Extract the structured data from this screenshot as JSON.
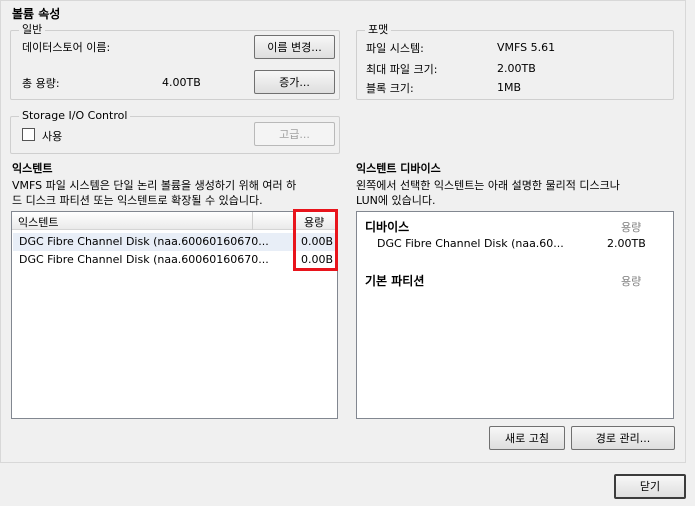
{
  "dialog": {
    "title": "볼륨 속성"
  },
  "general": {
    "group_label": "일반",
    "datastore_name_label": "데이터스토어 이름:",
    "rename_button": "이름 변경...",
    "total_capacity_label": "총 용량:",
    "total_capacity_value": "4.00TB",
    "increase_button": "증가..."
  },
  "format": {
    "group_label": "포맷",
    "filesystem_label": "파일 시스템:",
    "filesystem_value": "VMFS 5.61",
    "max_file_size_label": "최대 파일 크기:",
    "max_file_size_value": "2.00TB",
    "block_size_label": "블록 크기:",
    "block_size_value": "1MB"
  },
  "storage_io": {
    "group_label": "Storage I/O Control",
    "enable_label": "사용",
    "enabled": false,
    "advanced_button": "고급..."
  },
  "extents": {
    "heading": "익스텐트",
    "description_line1": "VMFS 파일 시스템은 단일 논리 볼륨을 생성하기 위해 여러 하",
    "description_line2": "드 디스크 파티션 또는 익스텐트로 확장될 수 있습니다.",
    "columns": {
      "name": "익스텐트",
      "capacity": "용량"
    },
    "rows": [
      {
        "name": "DGC Fibre Channel Disk (naa.60060160670...",
        "capacity": "0.00B"
      },
      {
        "name": "DGC Fibre Channel Disk (naa.60060160670...",
        "capacity": "0.00B"
      }
    ]
  },
  "extent_device": {
    "heading": "익스텐트 디바이스",
    "description_line1": "왼쪽에서 선택한 익스텐트는 아래 설명한 물리적 디스크나",
    "description_line2": "LUN에 있습니다.",
    "device_header": "디바이스",
    "device_capacity_header": "용량",
    "device_name": "DGC Fibre Channel Disk (naa.60...",
    "device_capacity": "2.00TB",
    "partition_header": "기본 파티션",
    "partition_capacity_header": "용량"
  },
  "buttons": {
    "refresh": "새로 고침",
    "manage_paths": "경로 관리...",
    "close": "닫기"
  },
  "colors": {
    "highlight": "#e8141c",
    "dialog_background": "#f0f0f0"
  }
}
